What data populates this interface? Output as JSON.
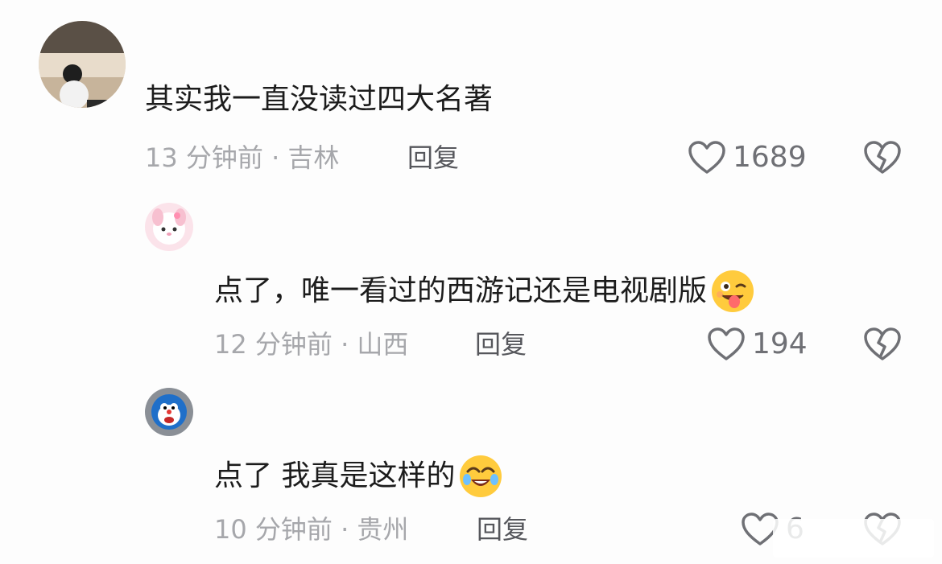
{
  "comments": [
    {
      "text": "其实我一直没读过四大名著",
      "time_location": "13 分钟前 · 吉林",
      "reply_label": "回复",
      "likes": "1689",
      "emoji": ""
    },
    {
      "text": "点了，唯一看过的西游记还是电视剧版",
      "time_location": "12 分钟前 · 山西",
      "reply_label": "回复",
      "likes": "194",
      "emoji": "wink-tongue-emoji"
    },
    {
      "text": "点了 我真是这样的",
      "time_location": "10 分钟前 · 贵州",
      "reply_label": "回复",
      "likes": "6",
      "emoji": "crying-laughing-emoji"
    }
  ],
  "colors": {
    "text": "#1c1c1c",
    "meta": "#a6a7ab",
    "reply": "#56575c",
    "icon": "#6f7075"
  }
}
